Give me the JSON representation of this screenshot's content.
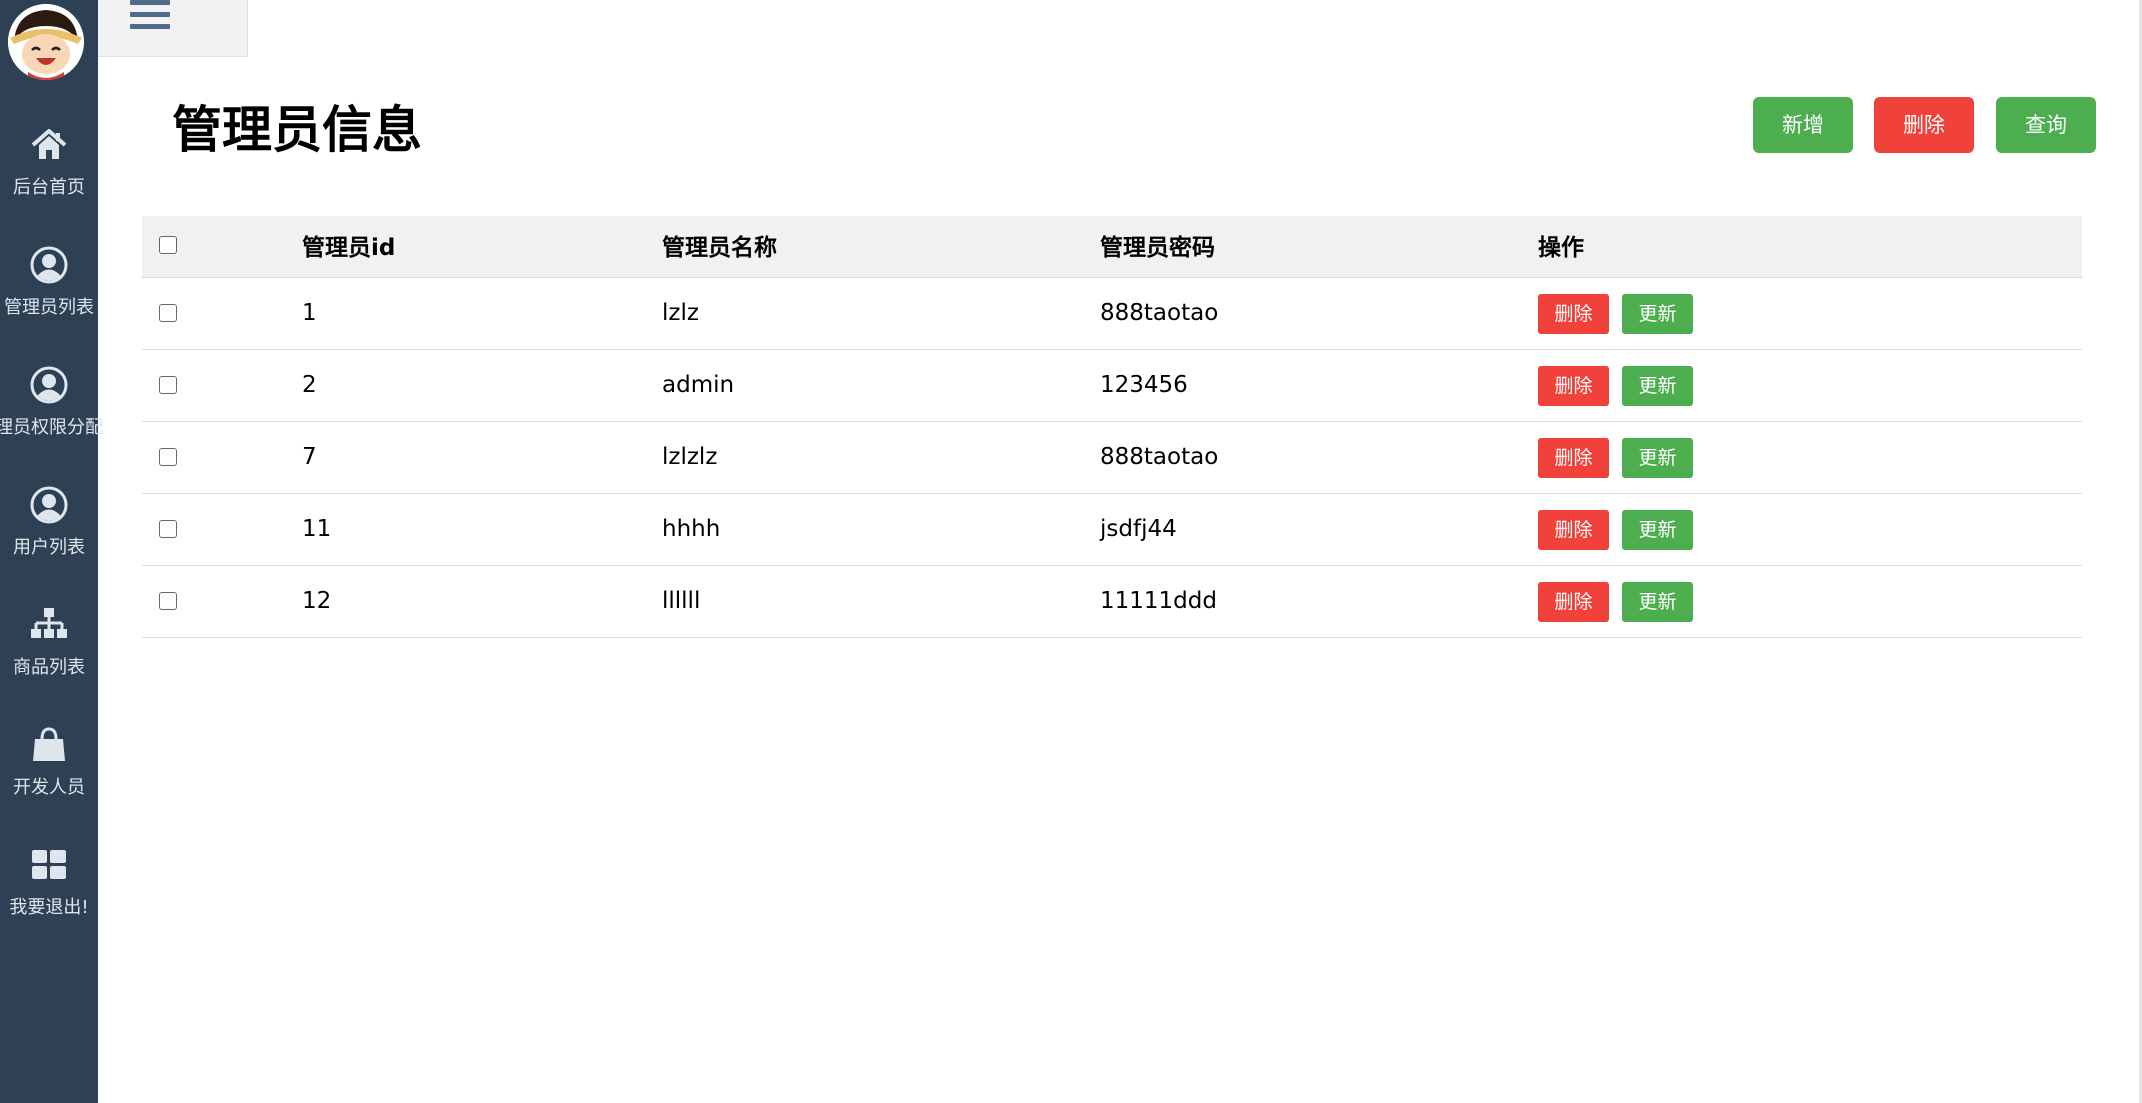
{
  "sidebar": {
    "items": [
      {
        "label": "后台首页",
        "icon": "home-icon"
      },
      {
        "label": "管理员列表",
        "icon": "user-circle-icon"
      },
      {
        "label": "理员权限分配",
        "icon": "user-circle-icon"
      },
      {
        "label": "用户列表",
        "icon": "user-circle-icon"
      },
      {
        "label": "商品列表",
        "icon": "sitemap-icon"
      },
      {
        "label": "开发人员",
        "icon": "shopping-bag-icon"
      },
      {
        "label": "我要退出!",
        "icon": "grid-icon"
      }
    ]
  },
  "header": {
    "menu_icon": "hamburger-icon"
  },
  "main": {
    "title": "管理员信息",
    "actions": {
      "add": "新增",
      "delete": "删除",
      "query": "查询"
    },
    "table": {
      "columns": [
        "管理员id",
        "管理员名称",
        "管理员密码",
        "操作"
      ],
      "rows": [
        {
          "id": "1",
          "name": "lzlz",
          "password": "888taotao"
        },
        {
          "id": "2",
          "name": "admin",
          "password": "123456"
        },
        {
          "id": "7",
          "name": "lzlzlz",
          "password": "888taotao"
        },
        {
          "id": "11",
          "name": "hhhh",
          "password": "jsdfj44"
        },
        {
          "id": "12",
          "name": "llllll",
          "password": "11111ddd"
        }
      ],
      "row_actions": {
        "delete": "删除",
        "update": "更新"
      }
    }
  },
  "colors": {
    "sidebar": "#2e4054",
    "green": "#4cae4f",
    "red": "#f0413a",
    "header_bg": "#f1f1f1"
  }
}
